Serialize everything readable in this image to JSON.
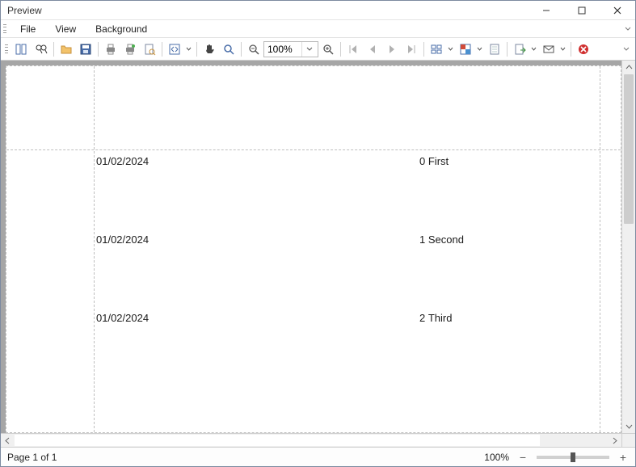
{
  "window": {
    "title": "Preview"
  },
  "menu": {
    "file": "File",
    "view": "View",
    "background": "Background"
  },
  "toolbar": {
    "zoom_value": "100%"
  },
  "report": {
    "rows": [
      {
        "date": "01/02/2024",
        "index": "0",
        "label": "First"
      },
      {
        "date": "01/02/2024",
        "index": "1",
        "label": "Second"
      },
      {
        "date": "01/02/2024",
        "index": "2",
        "label": "Third"
      }
    ]
  },
  "status": {
    "page_label": "Page 1 of 1",
    "zoom_label": "100%"
  }
}
